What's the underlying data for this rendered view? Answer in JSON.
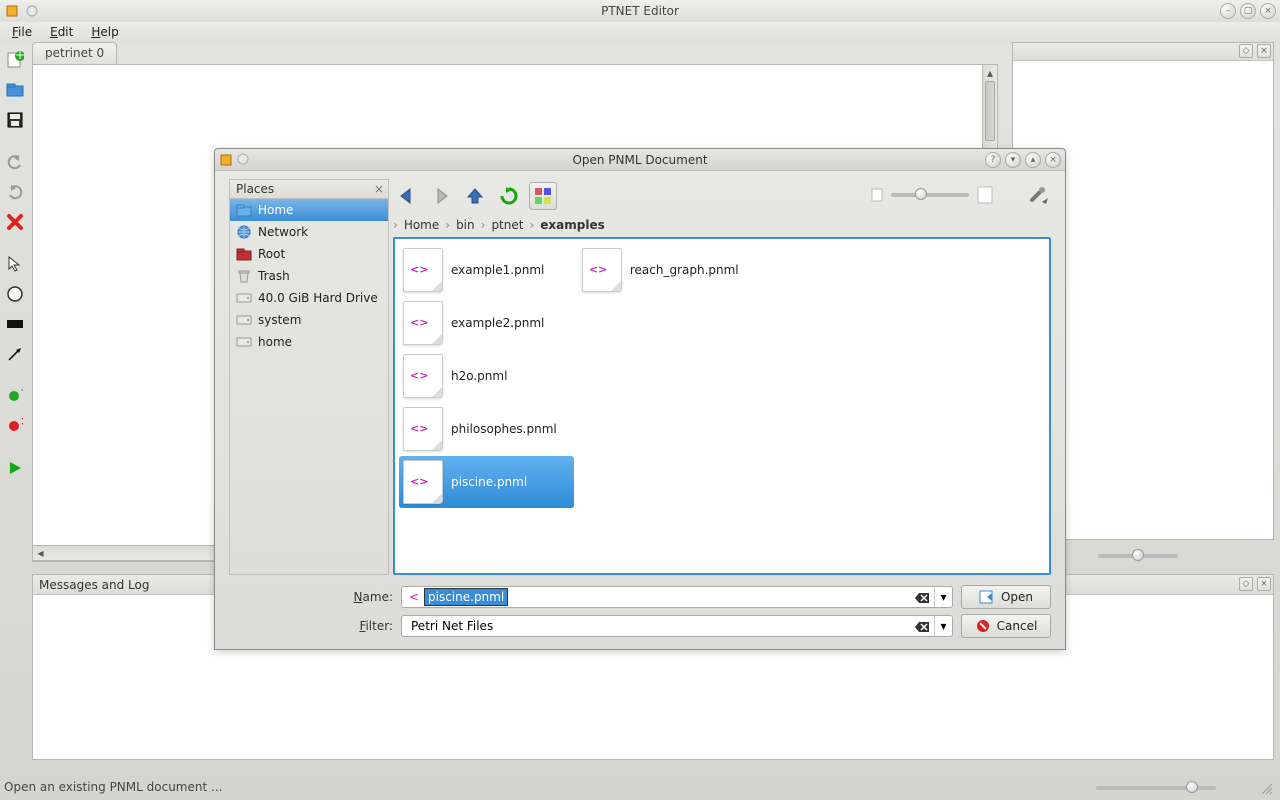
{
  "window": {
    "title": "PTNET Editor"
  },
  "menu": {
    "file": "File",
    "edit": "Edit",
    "help": "Help"
  },
  "tab": {
    "label": "petrinet 0"
  },
  "messages": {
    "title": "Messages and Log"
  },
  "statusbar": {
    "text": "Open an existing PNML document ..."
  },
  "dialog": {
    "title": "Open PNML Document",
    "places_header": "Places",
    "places": [
      {
        "label": "Home",
        "icon": "home-folder"
      },
      {
        "label": "Network",
        "icon": "globe"
      },
      {
        "label": "Root",
        "icon": "root-folder"
      },
      {
        "label": "Trash",
        "icon": "trash"
      },
      {
        "label": "40.0 GiB Hard Drive",
        "icon": "drive"
      },
      {
        "label": "system",
        "icon": "drive"
      },
      {
        "label": "home",
        "icon": "drive"
      }
    ],
    "breadcrumb": [
      "Home",
      "bin",
      "ptnet",
      "examples"
    ],
    "files_col1": [
      "example1.pnml",
      "example2.pnml",
      "h2o.pnml",
      "philosophes.pnml",
      "piscine.pnml"
    ],
    "files_col2": [
      "reach_graph.pnml"
    ],
    "selected_file": "piscine.pnml",
    "name_label": "Name:",
    "name_value": "piscine.pnml",
    "filter_label": "Filter:",
    "filter_value": "Petri Net Files",
    "open_btn": "Open",
    "cancel_btn": "Cancel"
  }
}
